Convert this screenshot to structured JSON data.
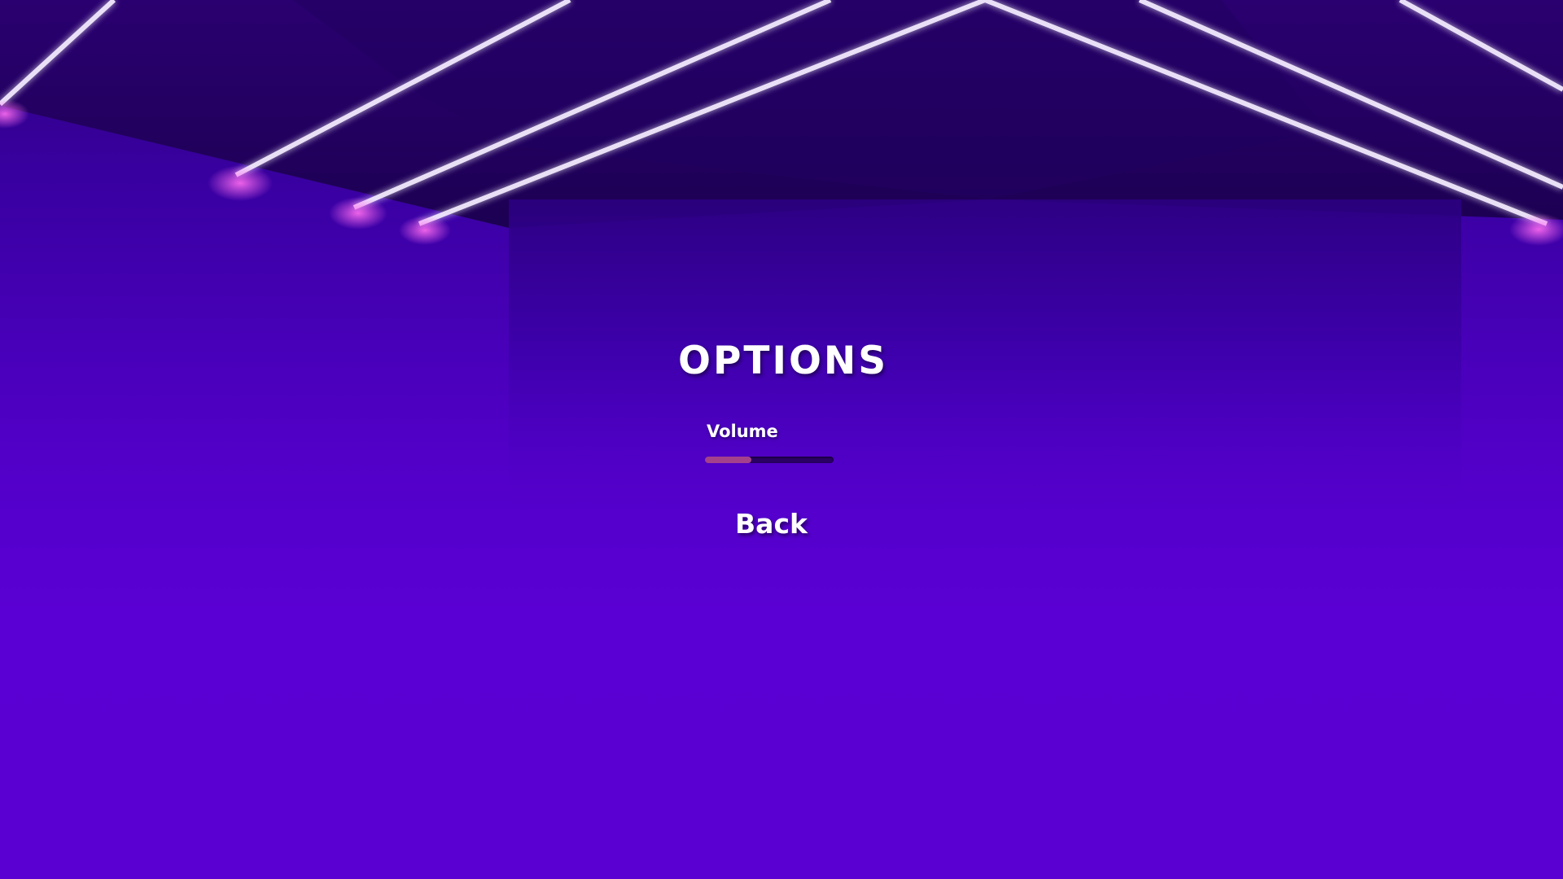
{
  "menu": {
    "title": "OPTIONS",
    "volume": {
      "label": "Volume",
      "value": 0.36
    },
    "back_label": "Back"
  },
  "colors": {
    "background": "#5a00d2",
    "slider_fill": "#a4418c",
    "slider_track": "#2a0064",
    "text": "#ffffff"
  }
}
